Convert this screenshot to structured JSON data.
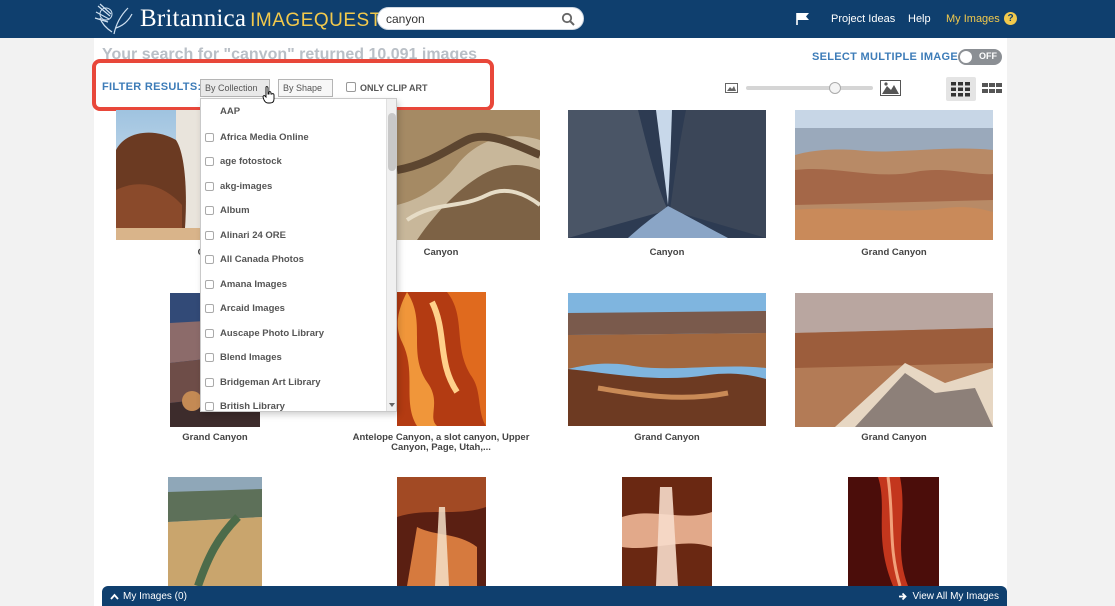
{
  "header": {
    "logo_britannica": "Britannica",
    "logo_imagequest": "IMAGEQUEST",
    "logo_tm": "™",
    "search_value": "canyon",
    "nav": {
      "project_ideas": "Project Ideas",
      "help": "Help",
      "my_images": "My Images",
      "help_badge": "?"
    }
  },
  "results": {
    "heading": "Your search for \"canyon\" returned 10,091 images",
    "select_multiple": "SELECT MULTIPLE IMAGES",
    "toggle_state": "OFF"
  },
  "filter": {
    "label": "FILTER RESULTS:",
    "by_collection": "By Collection",
    "by_shape": "By Shape",
    "only_clip_art": "ONLY CLIP ART"
  },
  "collections": [
    "AAP",
    "Africa Media Online",
    "age fotostock",
    "akg-images",
    "Album",
    "Alinari 24 ORE",
    "All Canada Photos",
    "Amana Images",
    "Arcaid Images",
    "Auscape Photo Library",
    "Blend Images",
    "Bridgeman Art Library",
    "British Library"
  ],
  "thumbnails": {
    "r1c1": "C",
    "r1c2": "Canyon",
    "r1c3": "Canyon",
    "r1c4": "Grand Canyon",
    "r2c1": "Grand Canyon",
    "r2c2_line1": "Antelope Canyon, a slot canyon, Upper",
    "r2c2_line2": "Canyon, Page, Utah,...",
    "r2c3": "Grand Canyon",
    "r2c4": "Grand Canyon"
  },
  "bottom_bar": {
    "my_images": "My Images (0)",
    "view_all": "View All My Images"
  },
  "colors": {
    "header_bg": "#0f3f6e",
    "accent_blue": "#3d7cb8",
    "logo_gold": "#f2c94c",
    "highlight_red": "#e8473a"
  }
}
